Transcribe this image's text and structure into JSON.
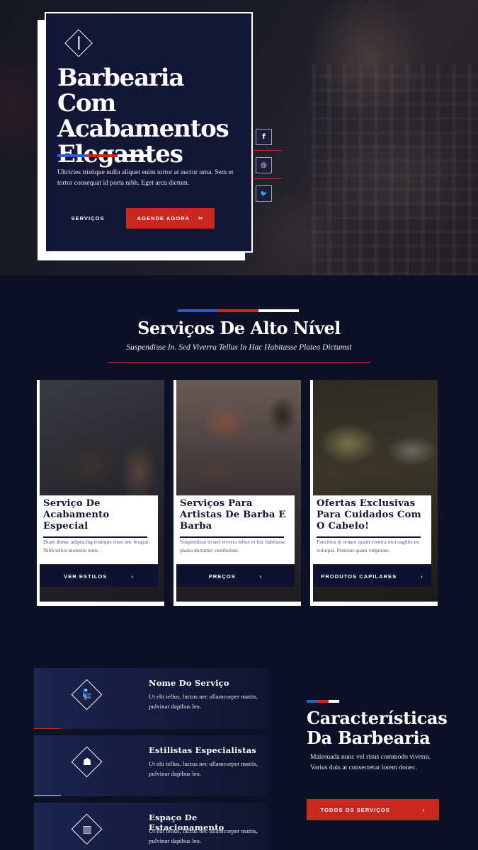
{
  "hero": {
    "title": "Barbearia Com Acabamentos Elegantes",
    "description": "Ultricies tristique nulla aliquet enim tortor at auctor urna. Sem et tortor consequat id porta nibh. Eget arcu dictum.",
    "btn_servicos": "SERVIÇOS",
    "btn_agende": "AGENDE AGORA",
    "btn_agende_icon": "✂",
    "social": [
      {
        "icon": "facebook-icon",
        "glyph": "f"
      },
      {
        "icon": "instagram-icon",
        "glyph": "◎"
      },
      {
        "icon": "twitter-icon",
        "glyph": "🐦"
      }
    ]
  },
  "services": {
    "title": "Serviços De Alto Nível",
    "subtitle": "Suspendisse In. Sed Viverra Tellus In Hac Habitasse Platea Dictumst",
    "cards": [
      {
        "title": "Serviço De Acabamento Especial",
        "text": "Diam donec adipiscing tristique risus nec feugiat. Nibh tellus molestie nunc.",
        "button": "VER ESTILOS",
        "arrow": "›"
      },
      {
        "title": "Serviços Para Artistas De Barba E Barba",
        "text": "Suspendisse in sed viverra tellus in hac habitasse platea dictumst vestibulum.",
        "button": "PREÇOS",
        "arrow": "›"
      },
      {
        "title": "Ofertas Exclusivas Para Cuidados Com O Cabelo!",
        "text": "Faucibus in ornare quam viverra orci sagittis eu volutpat. Pretium quam vulputate.",
        "button": "PRODUTOS CAPILARES",
        "arrow": "›"
      }
    ]
  },
  "features": {
    "items": [
      {
        "title": "Nome Do Serviço",
        "text": "Ut elit tellus, luctus nec ullamcorper mattis, pulvinar dapibus leo.",
        "icon": "barber-chair-icon",
        "glyph": "💺"
      },
      {
        "title": "Estilistas Especialistas",
        "text": "Ut elit tellus, luctus nec ullamcorper mattis, pulvinar dapibus leo.",
        "icon": "beard-icon",
        "glyph": "☗"
      },
      {
        "title": "Espaço De Estacionamento",
        "text": "Ut elit tellus, luctus nec ullamcorper mattis, pulvinar dapibus leo.",
        "icon": "barber-pole-icon",
        "glyph": "▥"
      }
    ],
    "heading": "Características Da Barbearia",
    "description": "Malesuada nunc vel risus commodo viverra. Varius duis at consectetur lorem donec.",
    "button": "TODOS OS SERVIÇOS",
    "button_arrow": "›"
  },
  "colors": {
    "navy": "#0d1126",
    "card_navy": "#121735",
    "red": "#c8281e",
    "blue": "#2d5fc4",
    "white": "#ffffff"
  }
}
